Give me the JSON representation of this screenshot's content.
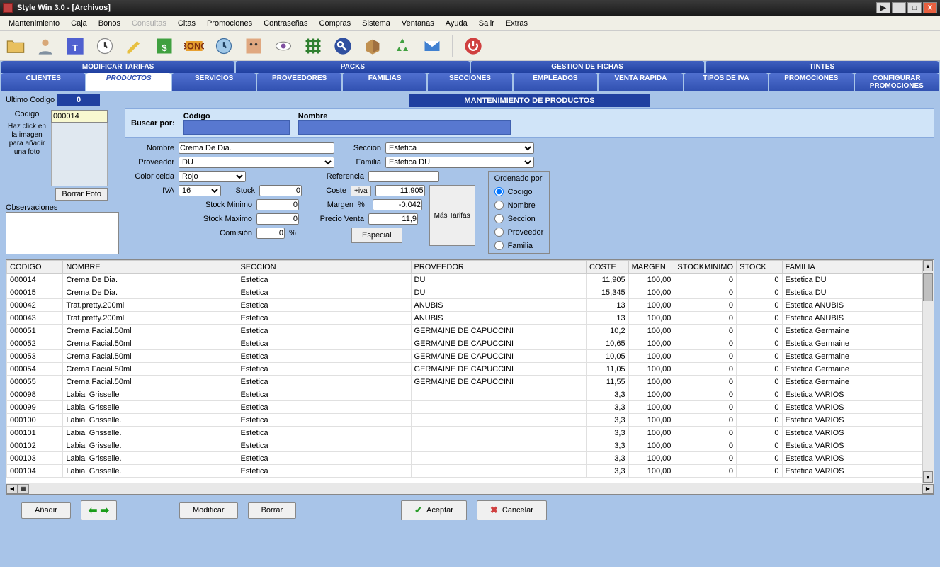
{
  "window": {
    "title": "Style Win 3.0 - [Archivos]"
  },
  "menu": [
    "Mantenimiento",
    "Caja",
    "Bonos",
    "Consultas",
    "Citas",
    "Promociones",
    "Contraseñas",
    "Compras",
    "Sistema",
    "Ventanas",
    "Ayuda",
    "Salir",
    "Extras"
  ],
  "menu_disabled_index": 3,
  "maintabs": [
    "MODIFICAR TARIFAS",
    "PACKS",
    "GESTION DE FICHAS",
    "TINTES"
  ],
  "subtabs": [
    "CLIENTES",
    "PRODUCTOS",
    "SERVICIOS",
    "PROVEEDORES",
    "FAMILIAS",
    "SECCIONES",
    "EMPLEADOS",
    "VENTA RAPIDA",
    "TIPOS DE IVA",
    "PROMOCIONES",
    "CONFIGURAR PROMOCIONES"
  ],
  "subtab_active_index": 1,
  "section_title": "MANTENIMIENTO DE PRODUCTOS",
  "left": {
    "ultimo_codigo_label": "Ultimo Codigo",
    "ultimo_codigo_value": "0",
    "codigo_label": "Codigo",
    "codigo_value": "000014",
    "photo_hint": "Haz click en la imagen para añadir una foto",
    "borrar_foto": "Borrar Foto",
    "observaciones_label": "Observaciones",
    "observaciones_value": ""
  },
  "search": {
    "buscar_por": "Buscar por:",
    "codigo_label": "Código",
    "codigo_value": "",
    "nombre_label": "Nombre",
    "nombre_value": ""
  },
  "form": {
    "nombre_label": "Nombre",
    "nombre_value": "Crema De Dia.",
    "seccion_label": "Seccion",
    "seccion_value": "Estetica",
    "proveedor_label": "Proveedor",
    "proveedor_value": "DU",
    "familia_label": "Familia",
    "familia_value": "Estetica DU",
    "color_label": "Color celda",
    "color_value": "Rojo",
    "referencia_label": "Referencia",
    "referencia_value": "",
    "iva_label": "IVA",
    "iva_value": "16",
    "stock_label": "Stock",
    "stock_value": "0",
    "coste_label": "Coste",
    "coste_btn": "+iva",
    "coste_value": "11,905",
    "stockmin_label": "Stock Minimo",
    "stockmin_value": "0",
    "margen_label": "Margen",
    "margen_pct": "%",
    "margen_value": "-0,042",
    "stockmax_label": "Stock Maximo",
    "stockmax_value": "0",
    "precio_label": "Precio Venta",
    "precio_value": "11,9",
    "comision_label": "Comisión",
    "comision_value": "0",
    "comision_pct": "%",
    "mas_tarifas": "Más Tarifas",
    "especial": "Especial"
  },
  "order": {
    "title": "Ordenado por",
    "options": [
      "Codigo",
      "Nombre",
      "Seccion",
      "Proveedor",
      "Familia"
    ],
    "selected": "Codigo"
  },
  "grid": {
    "columns": [
      "CODIGO",
      "NOMBRE",
      "SECCION",
      "PROVEEDOR",
      "COSTE",
      "MARGEN",
      "STOCKMINIMO",
      "STOCK",
      "FAMILIA"
    ],
    "rows": [
      [
        "000014",
        "Crema De Dia.",
        "Estetica",
        "DU",
        "11,905",
        "100,00",
        "0",
        "0",
        "Estetica DU"
      ],
      [
        "000015",
        "Crema De Dia.",
        "Estetica",
        "DU",
        "15,345",
        "100,00",
        "0",
        "0",
        "Estetica DU"
      ],
      [
        "000042",
        "Trat.pretty.200ml",
        "Estetica",
        "ANUBIS",
        "13",
        "100,00",
        "0",
        "0",
        "Estetica ANUBIS"
      ],
      [
        "000043",
        "Trat.pretty.200ml",
        "Estetica",
        "ANUBIS",
        "13",
        "100,00",
        "0",
        "0",
        "Estetica ANUBIS"
      ],
      [
        "000051",
        "Crema Facial.50ml",
        "Estetica",
        "GERMAINE DE CAPUCCINI",
        "10,2",
        "100,00",
        "0",
        "0",
        "Estetica Germaine"
      ],
      [
        "000052",
        "Crema Facial.50ml",
        "Estetica",
        "GERMAINE DE CAPUCCINI",
        "10,65",
        "100,00",
        "0",
        "0",
        "Estetica Germaine"
      ],
      [
        "000053",
        "Crema Facial.50ml",
        "Estetica",
        "GERMAINE DE CAPUCCINI",
        "10,05",
        "100,00",
        "0",
        "0",
        "Estetica Germaine"
      ],
      [
        "000054",
        "Crema Facial.50ml",
        "Estetica",
        "GERMAINE DE CAPUCCINI",
        "11,05",
        "100,00",
        "0",
        "0",
        "Estetica Germaine"
      ],
      [
        "000055",
        "Crema Facial.50ml",
        "Estetica",
        "GERMAINE DE CAPUCCINI",
        "11,55",
        "100,00",
        "0",
        "0",
        "Estetica Germaine"
      ],
      [
        "000098",
        "Labial Grisselle",
        "Estetica",
        "",
        "3,3",
        "100,00",
        "0",
        "0",
        "Estetica VARIOS"
      ],
      [
        "000099",
        "Labial Grisselle",
        "Estetica",
        "",
        "3,3",
        "100,00",
        "0",
        "0",
        "Estetica VARIOS"
      ],
      [
        "000100",
        "Labial Grisselle.",
        "Estetica",
        "",
        "3,3",
        "100,00",
        "0",
        "0",
        "Estetica VARIOS"
      ],
      [
        "000101",
        "Labial Grisselle.",
        "Estetica",
        "",
        "3,3",
        "100,00",
        "0",
        "0",
        "Estetica VARIOS"
      ],
      [
        "000102",
        "Labial Grisselle.",
        "Estetica",
        "",
        "3,3",
        "100,00",
        "0",
        "0",
        "Estetica VARIOS"
      ],
      [
        "000103",
        "Labial Grisselle.",
        "Estetica",
        "",
        "3,3",
        "100,00",
        "0",
        "0",
        "Estetica VARIOS"
      ],
      [
        "000104",
        "Labial Grisselle.",
        "Estetica",
        "",
        "3,3",
        "100,00",
        "0",
        "0",
        "Estetica VARIOS"
      ]
    ]
  },
  "bottom": {
    "anadir": "Añadir",
    "modificar": "Modificar",
    "borrar": "Borrar",
    "aceptar": "Aceptar",
    "cancelar": "Cancelar"
  }
}
